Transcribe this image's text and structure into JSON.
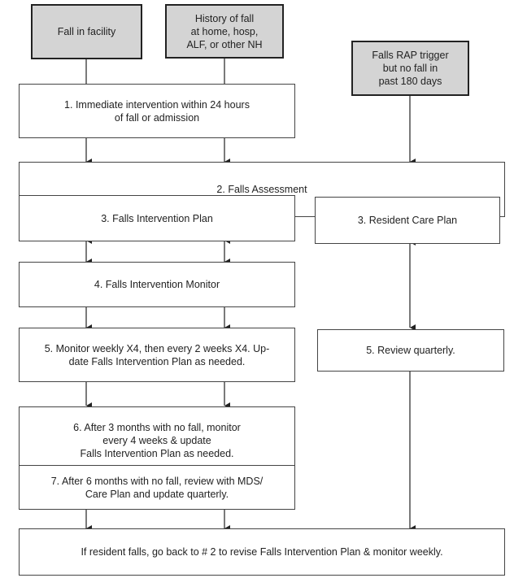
{
  "diagram": {
    "start_nodes": {
      "fall_in_facility": "Fall in facility",
      "history_of_fall": "History of fall\nat home, hosp,\nALF, or other NH",
      "rap_trigger": "Falls RAP trigger\nbut no fall in\npast 180 days"
    },
    "steps": {
      "step1": "1. Immediate intervention within 24 hours\nof fall or admission",
      "step2": "2.  Falls Assessment",
      "step3_left": "3.  Falls Intervention Plan",
      "step3_right": "3.  Resident Care Plan",
      "step4": "4.  Falls Intervention Monitor",
      "step5_left": "5.  Monitor weekly X4, then every 2 weeks X4. Up-\ndate Falls Intervention Plan as needed.",
      "step5_right": "5.  Review quarterly.",
      "step6": "6.  After 3 months with no fall, monitor\nevery 4 weeks & update\nFalls Intervention Plan as needed.",
      "step7": "7.  After 6 months with no fall, review with MDS/\nCare Plan and update quarterly.",
      "final": "If resident falls, go back to # 2 to revise Falls Intervention Plan & monitor weekly."
    },
    "colors": {
      "start_fill": "#d4d4d4",
      "line": "#222222"
    }
  }
}
